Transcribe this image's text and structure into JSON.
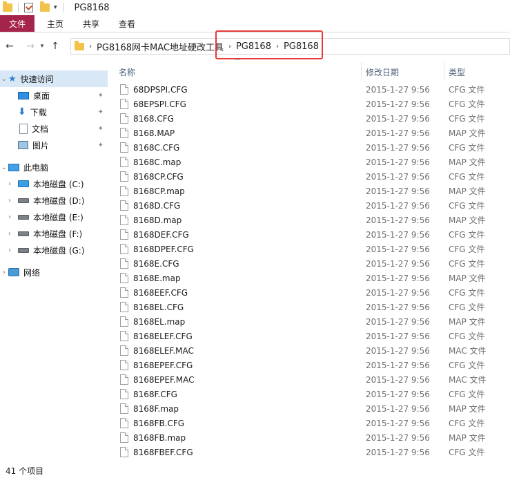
{
  "window": {
    "title": "PG8168"
  },
  "ribbon": {
    "tabs": [
      "文件",
      "主页",
      "共享",
      "查看"
    ]
  },
  "address": {
    "crumbs": [
      "PG8168网卡MAC地址硬改工具",
      "PG8168",
      "PG8168"
    ]
  },
  "nav": {
    "quick_access": "快速访问",
    "pinned": [
      "桌面",
      "下载",
      "文档",
      "图片"
    ],
    "this_pc": "此电脑",
    "drives": [
      "本地磁盘 (C:)",
      "本地磁盘 (D:)",
      "本地磁盘 (E:)",
      "本地磁盘 (F:)",
      "本地磁盘 (G:)"
    ],
    "network": "网络"
  },
  "columns": {
    "name": "名称",
    "date": "修改日期",
    "type": "类型"
  },
  "files": [
    {
      "name": "68DPSPI.CFG",
      "date": "2015-1-27 9:56",
      "type": "CFG 文件"
    },
    {
      "name": "68EPSPI.CFG",
      "date": "2015-1-27 9:56",
      "type": "CFG 文件"
    },
    {
      "name": "8168.CFG",
      "date": "2015-1-27 9:56",
      "type": "CFG 文件"
    },
    {
      "name": "8168.MAP",
      "date": "2015-1-27 9:56",
      "type": "MAP 文件"
    },
    {
      "name": "8168C.CFG",
      "date": "2015-1-27 9:56",
      "type": "CFG 文件"
    },
    {
      "name": "8168C.map",
      "date": "2015-1-27 9:56",
      "type": "MAP 文件"
    },
    {
      "name": "8168CP.CFG",
      "date": "2015-1-27 9:56",
      "type": "CFG 文件"
    },
    {
      "name": "8168CP.map",
      "date": "2015-1-27 9:56",
      "type": "MAP 文件"
    },
    {
      "name": "8168D.CFG",
      "date": "2015-1-27 9:56",
      "type": "CFG 文件"
    },
    {
      "name": "8168D.map",
      "date": "2015-1-27 9:56",
      "type": "MAP 文件"
    },
    {
      "name": "8168DEF.CFG",
      "date": "2015-1-27 9:56",
      "type": "CFG 文件"
    },
    {
      "name": "8168DPEF.CFG",
      "date": "2015-1-27 9:56",
      "type": "CFG 文件"
    },
    {
      "name": "8168E.CFG",
      "date": "2015-1-27 9:56",
      "type": "CFG 文件"
    },
    {
      "name": "8168E.map",
      "date": "2015-1-27 9:56",
      "type": "MAP 文件"
    },
    {
      "name": "8168EEF.CFG",
      "date": "2015-1-27 9:56",
      "type": "CFG 文件"
    },
    {
      "name": "8168EL.CFG",
      "date": "2015-1-27 9:56",
      "type": "CFG 文件"
    },
    {
      "name": "8168EL.map",
      "date": "2015-1-27 9:56",
      "type": "MAP 文件"
    },
    {
      "name": "8168ELEF.CFG",
      "date": "2015-1-27 9:56",
      "type": "CFG 文件"
    },
    {
      "name": "8168ELEF.MAC",
      "date": "2015-1-27 9:56",
      "type": "MAC 文件"
    },
    {
      "name": "8168EPEF.CFG",
      "date": "2015-1-27 9:56",
      "type": "CFG 文件"
    },
    {
      "name": "8168EPEF.MAC",
      "date": "2015-1-27 9:56",
      "type": "MAC 文件"
    },
    {
      "name": "8168F.CFG",
      "date": "2015-1-27 9:56",
      "type": "CFG 文件"
    },
    {
      "name": "8168F.map",
      "date": "2015-1-27 9:56",
      "type": "MAP 文件"
    },
    {
      "name": "8168FB.CFG",
      "date": "2015-1-27 9:56",
      "type": "CFG 文件"
    },
    {
      "name": "8168FB.map",
      "date": "2015-1-27 9:56",
      "type": "MAP 文件"
    },
    {
      "name": "8168FBEF.CFG",
      "date": "2015-1-27 9:56",
      "type": "CFG 文件"
    }
  ],
  "status": {
    "count": "41 个项目"
  },
  "colors": {
    "file_tab": "#a5254a",
    "highlight_box": "#e53b3b",
    "selected_nav": "#d9e8f7"
  }
}
